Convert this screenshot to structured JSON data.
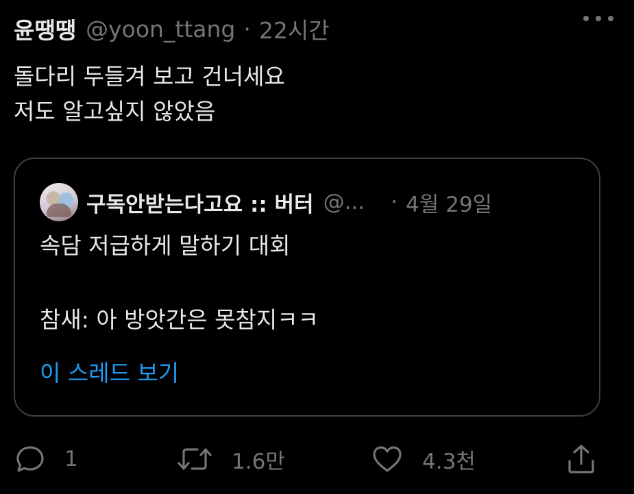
{
  "tweet": {
    "display_name": "윤땡땡",
    "handle": "@yoon_ttang",
    "separator": "·",
    "time": "22시간",
    "text_lines": [
      "돌다리 두들겨 보고 건너세요",
      "저도 알고싶지 않았음"
    ]
  },
  "quote": {
    "display_name": "구독안받는다고요 :: 버터",
    "handle": "@...",
    "separator": "·",
    "date": "4월 29일",
    "text_lines": [
      "속담 저급하게 말하기 대회",
      "",
      "참새: 아 방앗간은 못참지ㅋㅋ"
    ],
    "thread_link": "이 스레드 보기"
  },
  "actions": {
    "reply_count": "1",
    "retweet_count": "1.6만",
    "like_count": "4.3천"
  },
  "icons": {
    "more": "more-icon",
    "reply": "reply-icon",
    "retweet": "retweet-icon",
    "like": "heart-icon",
    "share": "share-icon"
  },
  "colors": {
    "background": "#000000",
    "text_primary": "#e7e9ea",
    "text_secondary": "#71767b",
    "link": "#1d9bf0",
    "border": "#3e4144"
  }
}
